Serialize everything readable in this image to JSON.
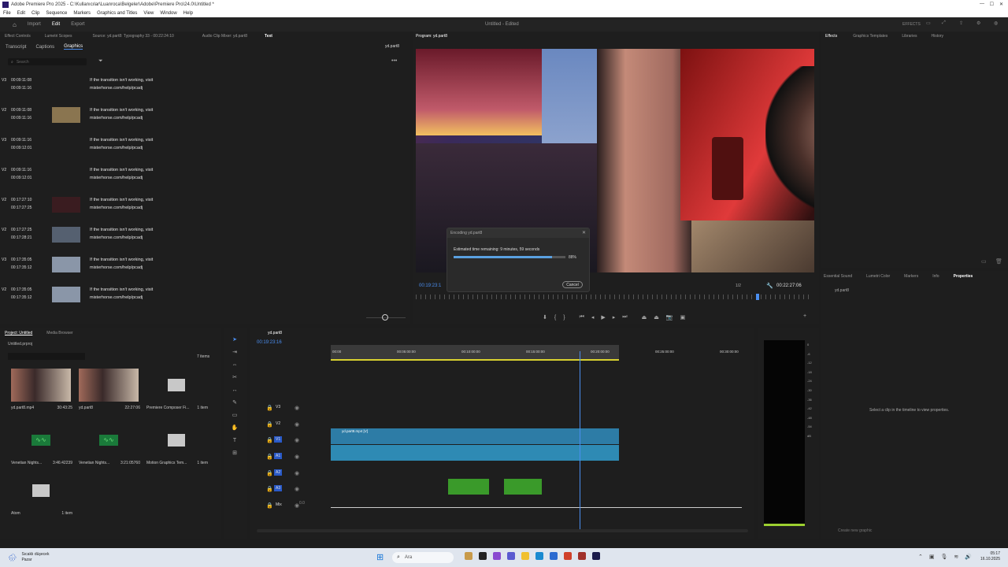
{
  "titlebar": {
    "title": "Adobe Premiere Pro 2025 - C:\\Kullanıcılar\\Luanroca\\Belgeler\\Adobe\\Premiere Pro\\24.0\\Untitled *"
  },
  "menu": [
    "File",
    "Edit",
    "Clip",
    "Sequence",
    "Markers",
    "Graphics and Titles",
    "View",
    "Window",
    "Help"
  ],
  "topbar": {
    "tabs": [
      "Import",
      "Edit",
      "Export"
    ],
    "active": "Edit",
    "center": "Untitled - Edited",
    "effects_label": "EFFECTS"
  },
  "source_panel": {
    "tabs": [
      "Effect Controls",
      "Lumetri Scopes",
      "Source: yd.part8: Typography 33 - 00:22:24:10",
      "Audio Clip Mixer: yd.part8",
      "Text"
    ],
    "subtabs": [
      "Transcript",
      "Captions",
      "Graphics"
    ],
    "seq_label": "yd.part8",
    "search_placeholder": "Search"
  },
  "captions": [
    {
      "track": "V3",
      "in": "00:09:11:08",
      "out": "00:09:11:16",
      "line1": "If the transition isn't working, visit",
      "line2": "misterhorse.com/help/pcadj",
      "thumb": ""
    },
    {
      "track": "V2",
      "in": "00:09:11:08",
      "out": "00:09:11:16",
      "line1": "If the transition isn't working, visit",
      "line2": "misterhorse.com/help/pcadj",
      "thumb": "#8a7550"
    },
    {
      "track": "V3",
      "in": "00:09:11:16",
      "out": "00:09:12:01",
      "line1": "If the transition isn't working, visit",
      "line2": "misterhorse.com/help/pcadj",
      "thumb": ""
    },
    {
      "track": "V2",
      "in": "00:09:11:16",
      "out": "00:09:12:01",
      "line1": "If the transition isn't working, visit",
      "line2": "misterhorse.com/help/pcadj",
      "thumb": ""
    },
    {
      "track": "V2",
      "in": "00:17:27:10",
      "out": "00:17:27:25",
      "line1": "If the transition isn't working, visit",
      "line2": "misterhorse.com/help/pcadj",
      "thumb": "#3a1c20"
    },
    {
      "track": "V2",
      "in": "00:17:27:25",
      "out": "00:17:28:21",
      "line1": "If the transition isn't working, visit",
      "line2": "misterhorse.com/help/pcadj",
      "thumb": "#556070"
    },
    {
      "track": "V3",
      "in": "00:17:35:05",
      "out": "00:17:35:12",
      "line1": "If the transition isn't working, visit",
      "line2": "misterhorse.com/help/pcadj",
      "thumb": "#8a96a8"
    },
    {
      "track": "V2",
      "in": "00:17:35:05",
      "out": "00:17:35:12",
      "line1": "If the transition isn't working, visit",
      "line2": "misterhorse.com/help/pcadj",
      "thumb": "#8a96a8"
    }
  ],
  "program": {
    "title": "Program: yd.part8",
    "timecode_left": "00:19:23:1",
    "timecode_right": "00:22:27:06",
    "fit": "1/2"
  },
  "encoding": {
    "title": "Encoding yd.part8",
    "message": "Estimated time remaining: 9 minutes, 59 seconds",
    "percent": "88%",
    "progress": 0.88,
    "cancel": "Cancel"
  },
  "right_panel": {
    "tabs": [
      "Effects",
      "Graphics Templates",
      "Libraries",
      "History"
    ],
    "tabs2": [
      "Essential Sound",
      "Lumetri Color",
      "Markers",
      "Info",
      "Properties"
    ],
    "seq_label": "yd.part8",
    "empty_msg": "Select a clip in the timeline to view properties.",
    "create": "Create new graphic"
  },
  "project": {
    "tabs": [
      "Project: Untitled",
      "Media Browser"
    ],
    "file": "Untitled.prproj",
    "items_count": "7 items",
    "items": [
      {
        "name": "yd.part8.mp4",
        "meta": "30:43:25",
        "kind": "video"
      },
      {
        "name": "yd.part8",
        "meta": "22:27:06",
        "kind": "video"
      },
      {
        "name": "Premiere Composer Fi...",
        "meta": "1 item",
        "kind": "folder"
      },
      {
        "name": "Venetian Nights...",
        "meta": "3:46:42239",
        "kind": "audio"
      },
      {
        "name": "Venetian Nights...",
        "meta": "3:21:05760",
        "kind": "audio"
      },
      {
        "name": "Motion Graphics Tem...",
        "meta": "1 item",
        "kind": "folder"
      },
      {
        "name": "Atom",
        "meta": "1 item",
        "kind": "folder"
      }
    ]
  },
  "timeline": {
    "title": "yd.part8",
    "timecode": "00:19:23:16",
    "ruler": [
      "00:00",
      "00:05:00:00",
      "00:10:00:00",
      "00:15:00:00",
      "00:20:00:00",
      "00:25:00:00",
      "00:30:00:00"
    ],
    "tracks": [
      "V3",
      "V2",
      "V1",
      "A1",
      "A2",
      "A3",
      "Mix"
    ],
    "mix_value": "0.0",
    "clip1": "yd.part8.mp4 [V]",
    "clip2": "yd.part8.mp4 [V]"
  },
  "meter": [
    "0",
    "-6",
    "-12",
    "-18",
    "-24",
    "-30",
    "-36",
    "-42",
    "-48",
    "-54",
    "dB"
  ],
  "taskbar": {
    "weather": "Sıcaklı düşecek",
    "weather2": "Pazar",
    "search": "Ara",
    "time": "05:17",
    "date": "16.10.2025"
  }
}
